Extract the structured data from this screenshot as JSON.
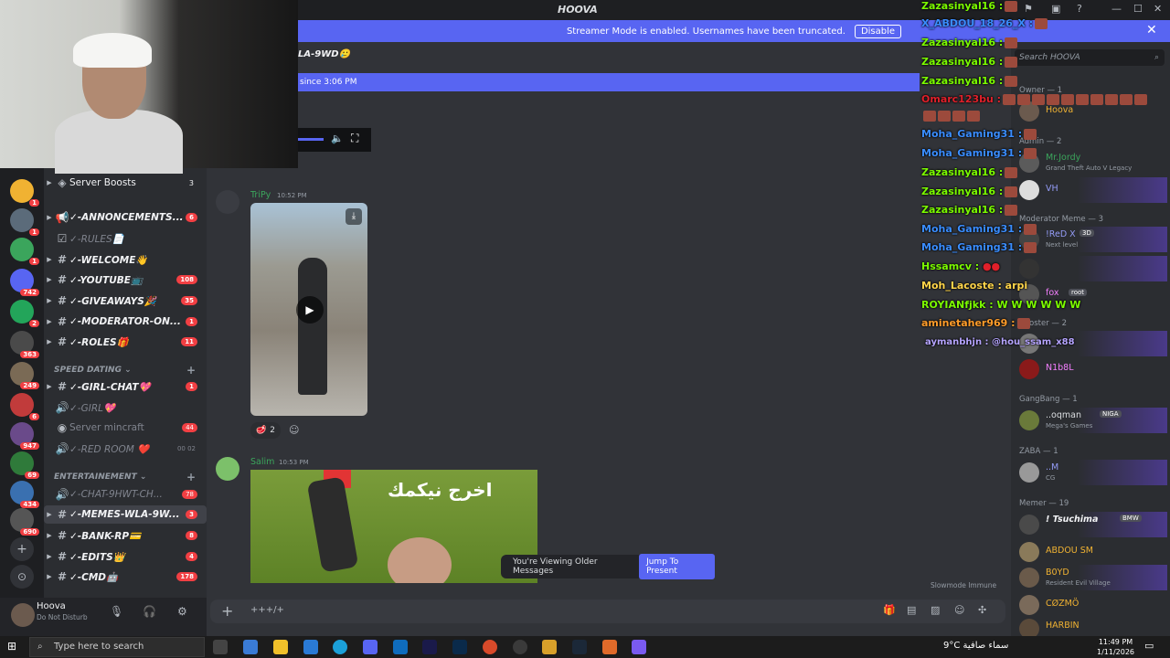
{
  "window": {
    "title": "HOOVA"
  },
  "banner": {
    "text": "Streamer Mode is enabled. Usernames have been truncated.",
    "disable_label": "Disable"
  },
  "header": {
    "channel_name": "LA-9WD🥲",
    "since_text": "since 3:06 PM"
  },
  "servers": [
    {
      "badge": "1",
      "color": "#f0b232"
    },
    {
      "badge": "1",
      "color": "#5b6b7a"
    },
    {
      "badge": "1",
      "color": "#3ba55c"
    },
    {
      "badge": "742",
      "color": "#5865f2"
    },
    {
      "badge": "2",
      "color": "#23a55a"
    },
    {
      "badge": "363",
      "color": "#4a4a4a"
    },
    {
      "badge": "249",
      "color": "#7a6a55"
    },
    {
      "badge": "6",
      "color": "#c13b3b"
    },
    {
      "badge": "947",
      "color": "#6a4a8a"
    },
    {
      "badge": "69",
      "color": "#2f7a3a"
    },
    {
      "badge": "434",
      "color": "#3a70b0"
    },
    {
      "badge": "690",
      "color": "#555"
    }
  ],
  "channels": {
    "server_boosts": {
      "name": "Server Boosts",
      "count": "3"
    },
    "items": [
      {
        "name": "✓-ANNONCEMENTS...",
        "count": "6"
      },
      {
        "name": "✓-RULES📄",
        "count": ""
      },
      {
        "name": "✓-WELCOME👋",
        "count": ""
      },
      {
        "name": "✓-YOUTUBE📺",
        "count": "108"
      },
      {
        "name": "✓-GIVEAWAYS🎉",
        "count": "35"
      },
      {
        "name": "✓-MODERATOR-ON...",
        "count": "1"
      },
      {
        "name": "✓-ROLES🎁",
        "count": "11"
      }
    ],
    "cat_speed": "SPEED DATING",
    "speed_items": [
      {
        "name": "✓-GIRL-CHAT💖",
        "count": "1"
      },
      {
        "name": "✓-GIRL💖",
        "count": ""
      },
      {
        "name": "Server mincraft",
        "count": "44"
      },
      {
        "name": "✓-RED ROOM ❤️",
        "count": "00 02"
      }
    ],
    "cat_ent": "ENTERTAINEMENT",
    "ent_items": [
      {
        "name": "✓-CHAT-9HWT-CH...",
        "count": "78"
      },
      {
        "name": "✓-MEMES-WLA-9W...",
        "count": "3"
      },
      {
        "name": "✓-BANK-RP💳",
        "count": "8"
      },
      {
        "name": "✓-EDITS👑",
        "count": "4"
      },
      {
        "name": "✓-CMD🤖",
        "count": "178"
      }
    ]
  },
  "user": {
    "name": "Hoova",
    "status": "Do Not Disturb"
  },
  "messages": [
    {
      "author": "TriPy",
      "time": "10:52 PM",
      "reaction_count": "2"
    },
    {
      "author": "Salim",
      "time": "10:53 PM",
      "image_text": "اخرج نيكمك"
    }
  ],
  "older": {
    "text": "You're Viewing Older Messages",
    "jump": "Jump To Present"
  },
  "slowmode": "Slowmode Immune",
  "composer": {
    "placeholder": "+++/+"
  },
  "member_search": "Search HOOVA",
  "member_groups": {
    "owner": "Owner — 1",
    "admin": "Admin — 2",
    "moderator": "Moderator Meme — 3",
    "booster": "Booster — 2",
    "gangbang": "GangBang — 1",
    "zaba": "ZABA — 1",
    "memer": "Memer — 19"
  },
  "members": [
    {
      "name": "Hoova",
      "sub": "",
      "color": "#f0b232"
    },
    {
      "name": "Mr.Jordy",
      "sub": "Grand Theft Auto V Legacy",
      "color": "#3ba55c"
    },
    {
      "name": "VH",
      "sub": "",
      "color": "#949cf7"
    },
    {
      "name": "!ReD X",
      "sub": "Next level",
      "color": "#949cf7",
      "tag": "3D"
    },
    {
      "name": "fox",
      "sub": "",
      "color": "#f47fff",
      "tag": "root"
    },
    {
      "name": "N1b8L",
      "sub": "",
      "color": "#f47fff"
    },
    {
      "name": "..oqman",
      "sub": "Mega's Games",
      "color": "#dbdee1",
      "tag": "NIGA"
    },
    {
      "name": "..M",
      "sub": "CG",
      "color": "#dbdee1"
    },
    {
      "name": "! Tsuchima",
      "sub": "",
      "color": "#f2f3f5",
      "tag": "BMW"
    },
    {
      "name": "ABDOU SM",
      "sub": "",
      "color": "#f0b232"
    },
    {
      "name": "B0YD",
      "sub": "Resident Evil Village",
      "color": "#f0b232"
    },
    {
      "name": "CØZMÖ",
      "sub": "",
      "color": "#f0b232"
    },
    {
      "name": "HARBIN",
      "sub": "",
      "color": "#f0b232"
    }
  ],
  "overlay_chat": [
    {
      "user": "Zazasinyal16 :",
      "color": "#7cfc00"
    },
    {
      "user": "X_ABDOU_18_26_X :",
      "color": "#3a8dff"
    },
    {
      "user": "Zazasinyal16 :",
      "color": "#7cfc00"
    },
    {
      "user": "Zazasinyal16 :",
      "color": "#7cfc00"
    },
    {
      "user": "Zazasinyal16 :",
      "color": "#7cfc00"
    },
    {
      "user": "Omarc123bu :",
      "color": "#e0202a"
    },
    {
      "user": "",
      "color": "#7cfc00"
    },
    {
      "user": "Moha_Gaming31 :",
      "color": "#3a8dff"
    },
    {
      "user": "Moha_Gaming31 :",
      "color": "#3a8dff"
    },
    {
      "user": "Zazasinyal16 :",
      "color": "#7cfc00"
    },
    {
      "user": "Zazasinyal16 :",
      "color": "#7cfc00"
    },
    {
      "user": "Zazasinyal16 :",
      "color": "#7cfc00"
    },
    {
      "user": "Moha_Gaming31 :",
      "color": "#3a8dff"
    },
    {
      "user": "Moha_Gaming31 :",
      "color": "#3a8dff"
    },
    {
      "user": "Hssamcv :",
      "color": "#7cfc00"
    },
    {
      "user": "Moh_Lacoste : arpi",
      "color": "#ffd54a"
    },
    {
      "user": "ROYIANfjkk :  W W W W W W",
      "color": "#7cfc00"
    },
    {
      "user": "aminetaher969 :",
      "color": "#ff9c2a"
    },
    {
      "user": "aymanbhjn : @hou_ssam_x88",
      "color": "#b5a4ff"
    }
  ],
  "taskbar": {
    "search_placeholder": "Type here to search",
    "weather": "9°C  سماء صافية",
    "time": "11:49 PM",
    "date": "1/11/2026"
  }
}
